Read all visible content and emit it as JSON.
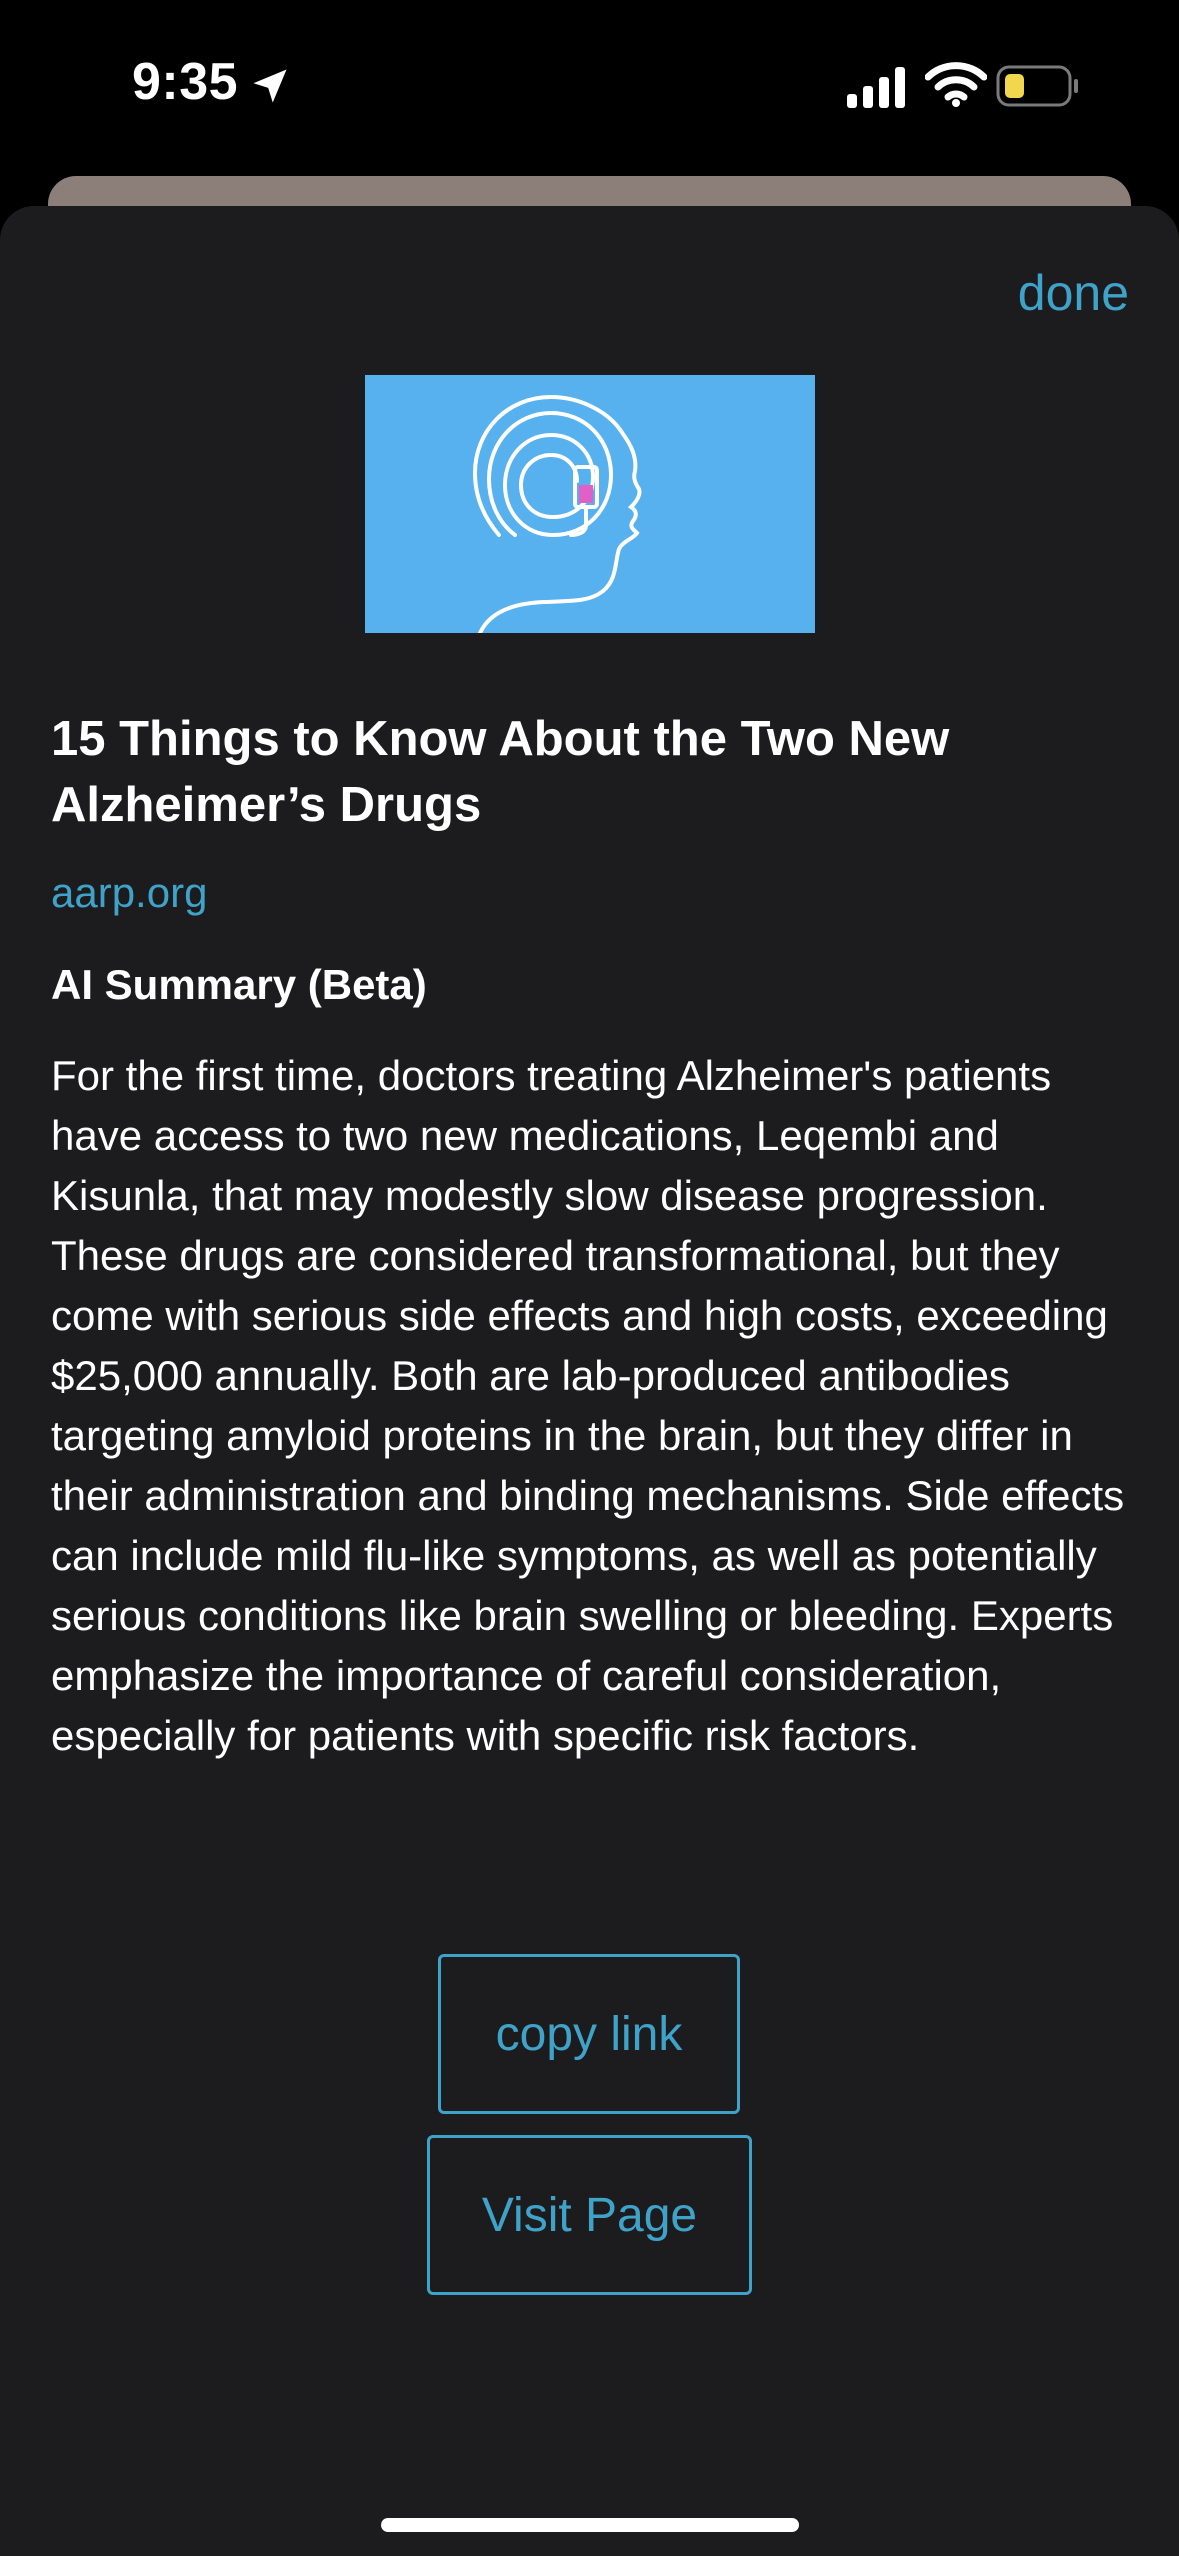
{
  "status_bar": {
    "time": "9:35",
    "icons": [
      "location-arrow-icon",
      "cellular-signal-icon",
      "wifi-icon",
      "battery-low-icon"
    ],
    "battery_color": "#f2d74e"
  },
  "sheet": {
    "done_label": "done",
    "thumbnail": "head-with-maze-and-iv-bag-illustration",
    "title": "15 Things to Know About the Two New Alzheimer’s Drugs",
    "source": "aarp.org",
    "summary_heading": "AI Summary (Beta)",
    "summary": "For the first time, doctors treating Alzheimer's patients have access to two new medications, Leqembi and Kisunla, that may modestly slow disease progression. These drugs are considered transformational, but they come with serious side effects and high costs, exceeding $25,000 annually. Both are lab-produced antibodies targeting amyloid proteins in the brain, but they differ in their administration and binding mechanisms. Side effects can include mild flu-like symptoms, as well as potentially serious conditions like brain swelling or bleeding. Experts emphasize the importance of careful consideration, especially for patients with specific risk factors.",
    "copy_link_label": "copy link",
    "visit_page_label": "Visit Page"
  },
  "colors": {
    "accent": "#3fa3c9",
    "sheet_background": "#1c1c1e",
    "thumbnail_background": "#56b1ee"
  }
}
